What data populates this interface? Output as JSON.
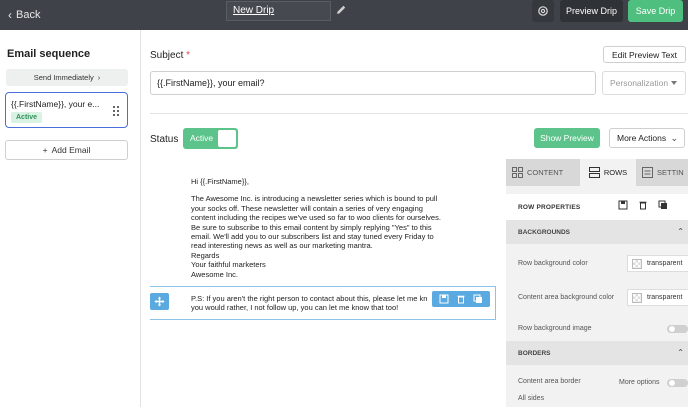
{
  "topbar": {
    "back_label": "Back",
    "title": "New Drip",
    "preview_label": "Preview Drip",
    "save_label": "Save Drip"
  },
  "sidebar": {
    "heading": "Email sequence",
    "send_immediately": "Send Immediately",
    "emails": [
      {
        "subject": "{{.FirstName}}, your e...",
        "status": "Active"
      }
    ],
    "add_email_label": "Add Email"
  },
  "editor": {
    "subject_label": "Subject",
    "required_mark": "*",
    "edit_preview_text_label": "Edit Preview Text",
    "subject_value": "{{.FirstName}}, your email?",
    "personalization_placeholder": "Personalization",
    "status_label": "Status",
    "status_toggle_text": "Active",
    "show_preview_label": "Show Preview",
    "more_actions_label": "More Actions"
  },
  "email_body": {
    "greeting": "Hi {{.FirstName}},",
    "paragraph_lines": [
      "The Awesome Inc. is introducing a newsletter series which is bound to pull",
      "your socks off. These newsletter will contain a series of very engaging",
      "content including the recipes we've used so far to woo clients for ourselves.",
      "Be sure to subscribe to this email content by simply replying \"Yes\" to this",
      "email. We'll add you to our subscribers list and stay tuned every Friday to",
      "read interesting news as well as our marketing mantra.",
      "Regards",
      "Your faithful marketers",
      "Awesome Inc."
    ],
    "ps_lines": [
      "P.S: If you aren't the right person to contact about this, please let me kn",
      "you would rather, I not follow up, you can let me know that too!"
    ]
  },
  "panel": {
    "tabs": {
      "content": "CONTENT",
      "rows": "ROWS",
      "settings": "SETTIN"
    },
    "row_properties": "ROW PROPERTIES",
    "backgrounds_heading": "BACKGROUNDS",
    "row_bg_label": "Row background color",
    "row_bg_value": "transparent",
    "content_bg_label": "Content area background color",
    "content_bg_value": "transparent",
    "row_bg_image_label": "Row background image",
    "borders_heading": "BORDERS",
    "content_border_label": "Content area border",
    "more_options_label": "More options",
    "all_sides_label": "All sides"
  },
  "colors": {
    "topbar": "#3f4248",
    "accent_green": "#5cc48a",
    "selection_blue": "#5aa9e0",
    "card_border": "#4a6fd8"
  }
}
